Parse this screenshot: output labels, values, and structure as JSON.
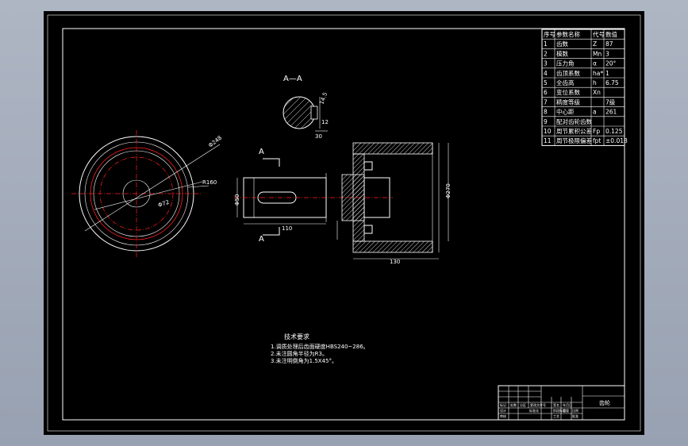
{
  "drawing": {
    "section_label": "A—A",
    "cut_label_top": "A",
    "cut_label_bottom": "A",
    "technical_requirements": {
      "title": "技术要求",
      "items": [
        "1.调质处理后齿面硬度HBS240~286。",
        "2.未注圆角半径为R3。",
        "3.未注明倒角为1.5X45°。"
      ]
    },
    "params_table": {
      "headers": [
        "序号",
        "参数名称",
        "代号",
        "数值"
      ],
      "rows": [
        [
          "1",
          "齿数",
          "Z",
          "87"
        ],
        [
          "2",
          "模数",
          "Mn",
          "3"
        ],
        [
          "3",
          "压力角",
          "α",
          "20°"
        ],
        [
          "4",
          "齿顶系数",
          "ha*",
          "1"
        ],
        [
          "5",
          "全齿高",
          "h",
          "6.75"
        ],
        [
          "6",
          "变位系数",
          "Xn",
          ""
        ],
        [
          "7",
          "精度等级",
          "",
          "7级"
        ],
        [
          "8",
          "中心距",
          "a",
          "261"
        ],
        [
          "9",
          "配对齿轮齿数",
          "",
          ""
        ],
        [
          "10",
          "周节累积公差",
          "Fp",
          "0.125"
        ],
        [
          "11",
          "周节极限偏差",
          "fpt",
          "±0.018"
        ]
      ]
    },
    "title_block": {
      "part_name": "齿轮",
      "labels": [
        "标记",
        "处数",
        "分区",
        "更改文件号",
        "签名",
        "年月日",
        "设计",
        "审核",
        "工艺",
        "标准化",
        "批准",
        "阶段标记",
        "重量",
        "比例"
      ]
    }
  }
}
